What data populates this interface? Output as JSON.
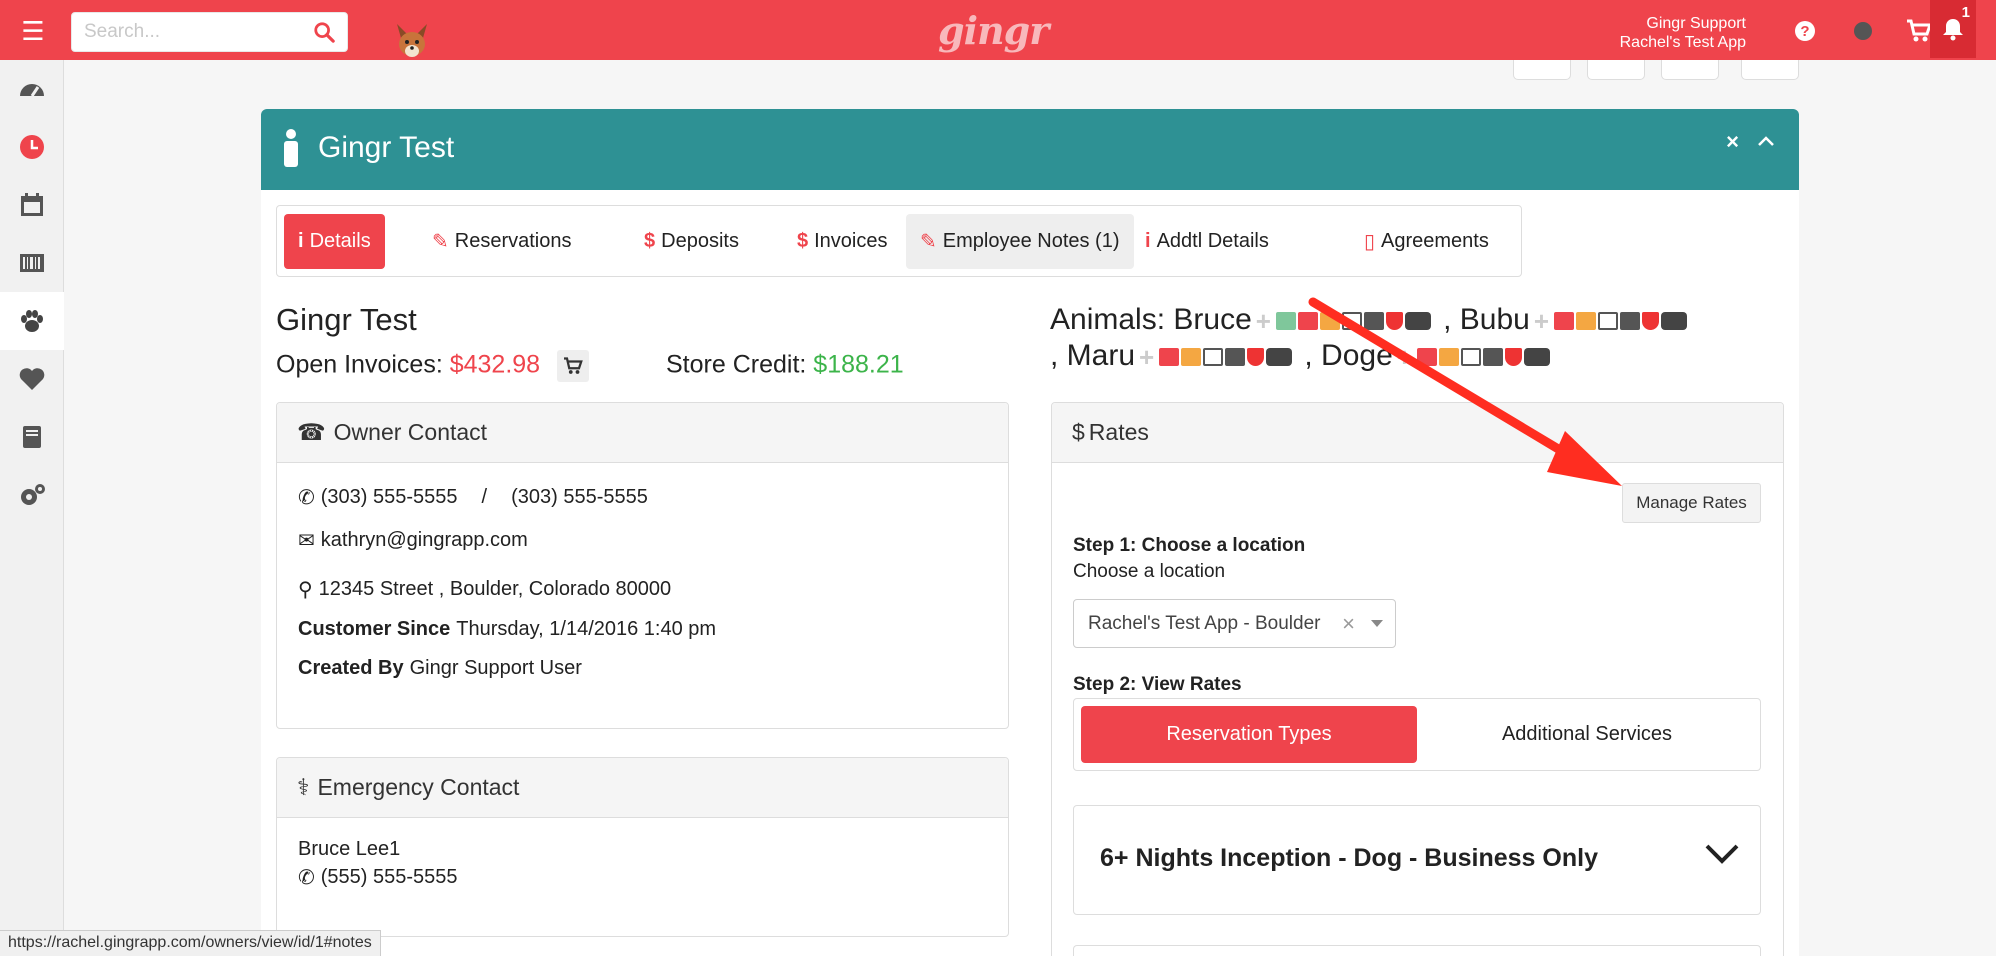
{
  "topbar": {
    "search_placeholder": "Search...",
    "logo": "gingr",
    "support_name": "Gingr Support",
    "support_app": "Rachel's Test App",
    "notification_count": "1"
  },
  "sidebar": {
    "items": [
      "dashboard-icon",
      "clock-icon",
      "calendar-icon",
      "barcode-icon",
      "paw-icon",
      "heart-icon",
      "book-icon",
      "gears-icon"
    ]
  },
  "panel": {
    "title": "Gingr Test",
    "close": "×",
    "collapse": "^"
  },
  "tabs": [
    {
      "label": "Details",
      "icon": "i"
    },
    {
      "label": "Reservations",
      "icon": "✎"
    },
    {
      "label": "Deposits",
      "icon": "$"
    },
    {
      "label": "Invoices",
      "icon": "$"
    },
    {
      "label": "Employee Notes (1)",
      "icon": "✎"
    },
    {
      "label": "Addtl Details",
      "icon": "i"
    },
    {
      "label": "Agreements",
      "icon": "▯"
    }
  ],
  "owner": {
    "name": "Gingr Test",
    "open_invoices_label": "Open Invoices:",
    "open_invoices_value": "$432.98",
    "store_credit_label": "Store Credit:",
    "store_credit_value": "$188.21"
  },
  "owner_contact": {
    "header": "Owner Contact",
    "phone1": "(303) 555-5555",
    "separator": "/",
    "phone2": "(303) 555-5555",
    "email": "kathryn@gingrapp.com",
    "address": "12345 Street , Boulder, Colorado 80000",
    "customer_since_label": "Customer Since",
    "customer_since_value": "Thursday, 1/14/2016 1:40 pm",
    "created_by_label": "Created By",
    "created_by_value": "Gingr Support User"
  },
  "emergency_contact": {
    "header": "Emergency Contact",
    "name": "Bruce Lee1",
    "phone": "(555) 555-5555"
  },
  "animals": {
    "label": "Animals:",
    "names": [
      "Bruce",
      ", Bubu",
      ", Maru",
      ", Doge"
    ]
  },
  "rates": {
    "header": "Rates",
    "manage_button": "Manage Rates",
    "step1_title": "Step 1: Choose a location",
    "step1_sub": "Choose a location",
    "location_value": "Rachel's Test App - Boulder",
    "step2_title": "Step 2: View Rates",
    "toggle_on": "Reservation Types",
    "toggle_off": "Additional Services",
    "accordion_title": "6+ Nights Inception - Dog - Business Only"
  },
  "statusbar": {
    "url": "https://rachel.gingrapp.com/owners/view/id/1#notes"
  },
  "colors": {
    "brand_red": "#ef444c",
    "teal": "#2e9194",
    "green": "#3cb44a"
  }
}
